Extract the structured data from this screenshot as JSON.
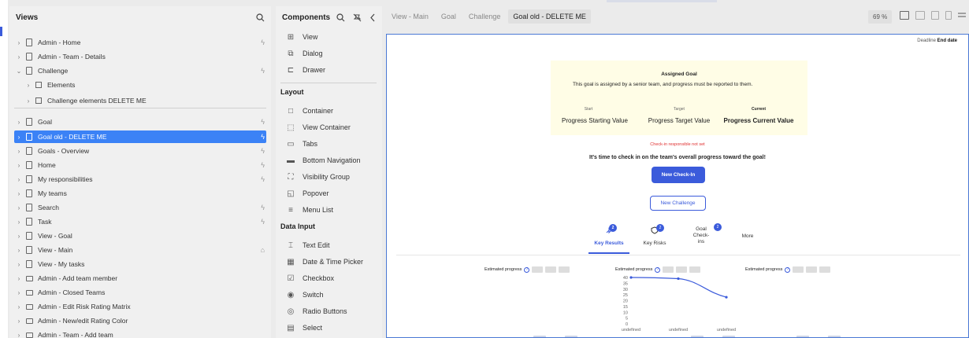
{
  "views_panel": {
    "title": "Views",
    "items": [
      {
        "label": "Admin - Home",
        "icon": "doc",
        "level": 0,
        "trail": "lightning"
      },
      {
        "label": "Admin - Team - Details",
        "icon": "doc",
        "level": 0,
        "trail": ""
      },
      {
        "label": "Challenge",
        "icon": "doc",
        "level": 0,
        "trail": "lightning",
        "expanded": true
      },
      {
        "label": "Elements",
        "icon": "square",
        "level": 1,
        "trail": ""
      },
      {
        "label": "Challenge elements DELETE ME",
        "icon": "square",
        "level": 1,
        "trail": ""
      },
      {
        "label": "Goal",
        "icon": "doc",
        "level": 0,
        "trail": "lightning"
      },
      {
        "label": "Goal old - DELETE ME",
        "icon": "doc",
        "level": 0,
        "trail": "lightning",
        "selected": true
      },
      {
        "label": "Goals - Overview",
        "icon": "doc",
        "level": 0,
        "trail": "lightning"
      },
      {
        "label": "Home",
        "icon": "doc",
        "level": 0,
        "trail": "lightning"
      },
      {
        "label": "My responsibilities",
        "icon": "doc",
        "level": 0,
        "trail": "lightning"
      },
      {
        "label": "My teams",
        "icon": "doc",
        "level": 0,
        "trail": ""
      },
      {
        "label": "Search",
        "icon": "doc",
        "level": 0,
        "trail": "lightning"
      },
      {
        "label": "Task",
        "icon": "doc",
        "level": 0,
        "trail": "lightning"
      },
      {
        "label": "View - Goal",
        "icon": "doc",
        "level": 0,
        "trail": ""
      },
      {
        "label": "View - Main",
        "icon": "doc",
        "level": 0,
        "trail": "home"
      },
      {
        "label": "View - My tasks",
        "icon": "doc",
        "level": 0,
        "trail": ""
      },
      {
        "label": "Admin - Add team member",
        "icon": "rect",
        "level": 0,
        "trail": ""
      },
      {
        "label": "Admin - Closed Teams",
        "icon": "rect",
        "level": 0,
        "trail": ""
      },
      {
        "label": "Admin - Edit Risk Rating Matrix",
        "icon": "rect",
        "level": 0,
        "trail": ""
      },
      {
        "label": "Admin - New/edit Rating Color",
        "icon": "rect",
        "level": 0,
        "trail": ""
      },
      {
        "label": "Admin - Team - Add team",
        "icon": "rect",
        "level": 0,
        "trail": ""
      }
    ]
  },
  "components_panel": {
    "title": "Components",
    "top_items": [
      "View",
      "Dialog",
      "Drawer"
    ],
    "sections": [
      {
        "name": "Layout",
        "items": [
          "Container",
          "View Container",
          "Tabs",
          "Bottom Navigation",
          "Visibility Group",
          "Popover",
          "Menu List"
        ]
      },
      {
        "name": "Data Input",
        "items": [
          "Text Edit",
          "Date & Time Picker",
          "Checkbox",
          "Switch",
          "Radio Buttons",
          "Select"
        ]
      }
    ]
  },
  "breadcrumbs": [
    "View - Main",
    "Goal",
    "Challenge",
    "Goal old - DELETE ME"
  ],
  "zoom_label": "69 %",
  "canvas": {
    "deadline_label": "Deadline",
    "deadline_value": "End date",
    "goal_card": {
      "title": "Assigned Goal",
      "description": "This goal is assigned by a senior team, and progress must be reported to them.",
      "start_label": "Start",
      "start_value": "Progress Starting Value",
      "target_label": "Target",
      "target_value": "Progress Target Value",
      "current_label": "Current",
      "current_value": "Progress Current Value"
    },
    "warning": "Check-in responsible not set",
    "cta_text": "It's time to check in on the team's overall progress toward the goal!",
    "new_checkin_label": "New Check-In",
    "new_challenge_label": "New Challenge",
    "tabs": [
      {
        "label": "Key Results",
        "badge": "2",
        "active": true
      },
      {
        "label": "Key Risks",
        "badge": "2",
        "active": false
      },
      {
        "label": "Goal Check-ins",
        "badge": "2",
        "active": false
      },
      {
        "label": "More",
        "badge": "",
        "active": false
      }
    ],
    "estimated_progress_label": "Estimated progress",
    "chart_data": {
      "type": "line",
      "categories": [
        "undefined",
        "undefined",
        "undefined"
      ],
      "series": [
        {
          "values": [
            40,
            39,
            23
          ]
        }
      ],
      "yticks": [
        "40",
        "35",
        "30",
        "25",
        "20",
        "15",
        "10",
        "5",
        "0"
      ],
      "ylim": [
        0,
        40
      ],
      "line_color": "#3b5bdb"
    }
  }
}
